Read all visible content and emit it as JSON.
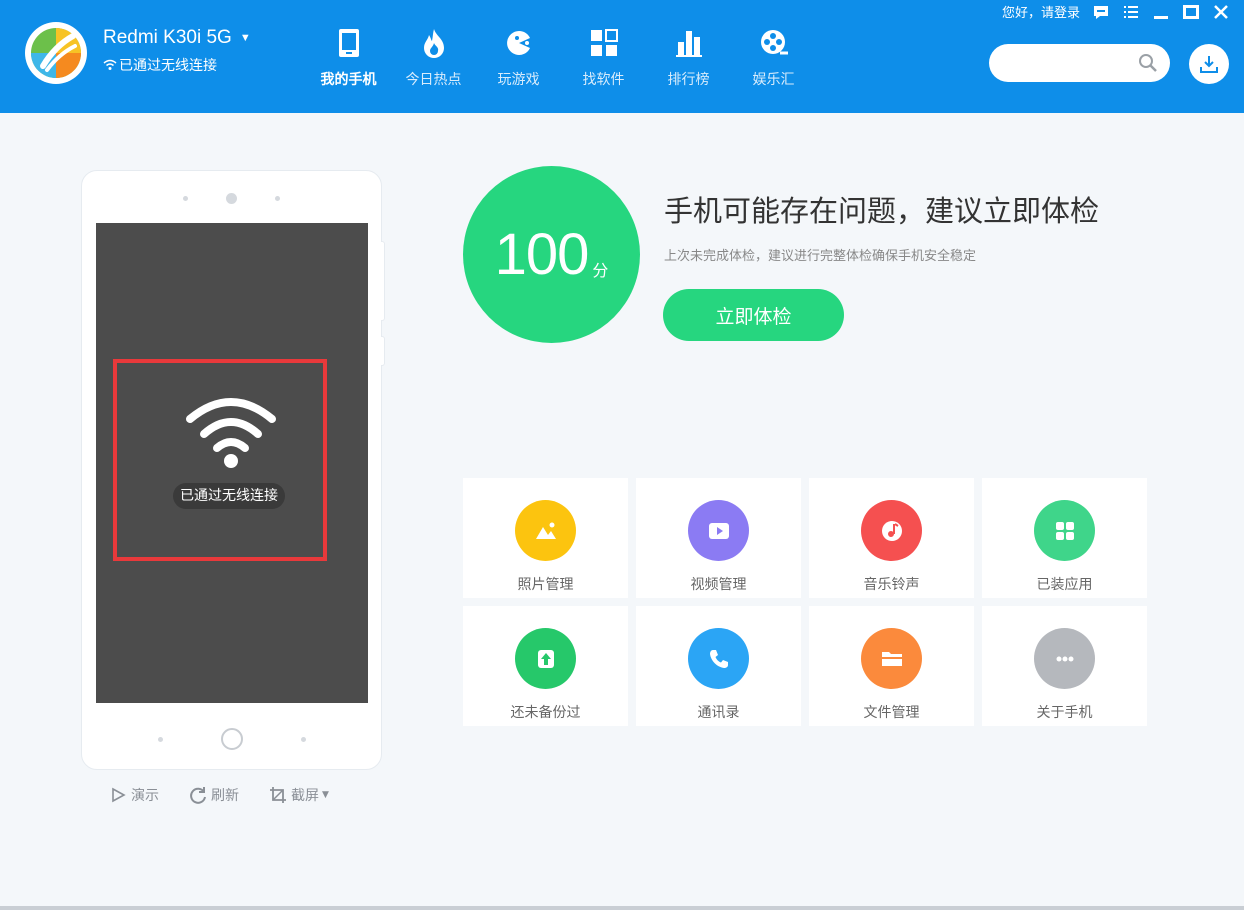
{
  "header": {
    "device_name": "Redmi K30i 5G",
    "device_status": "已通过无线连接",
    "nav": [
      {
        "label": "我的手机",
        "icon": "phone-icon",
        "active": true
      },
      {
        "label": "今日热点",
        "icon": "flame-icon",
        "active": false
      },
      {
        "label": "玩游戏",
        "icon": "pacman-icon",
        "active": false
      },
      {
        "label": "找软件",
        "icon": "apps-grid-icon",
        "active": false
      },
      {
        "label": "排行榜",
        "icon": "bar-chart-icon",
        "active": false
      },
      {
        "label": "娱乐汇",
        "icon": "film-reel-icon",
        "active": false
      }
    ],
    "login_text": "您好，请登录",
    "search_placeholder": "",
    "brand_color": "#0e8ee9"
  },
  "phone": {
    "screen_label": "已通过无线连接",
    "actions": [
      {
        "label": "演示",
        "icon": "play-icon"
      },
      {
        "label": "刷新",
        "icon": "refresh-icon"
      },
      {
        "label": "截屏",
        "icon": "crop-icon"
      }
    ]
  },
  "score": {
    "value": "100",
    "unit": "分",
    "title": "手机可能存在问题，建议立即体检",
    "subtitle": "上次未完成体检，建议进行完整体检确保手机安全稳定",
    "button_label": "立即体检",
    "color": "#26d67f"
  },
  "tiles": [
    {
      "label": "照片管理",
      "icon": "photo-icon",
      "color": "#fcc40f"
    },
    {
      "label": "视频管理",
      "icon": "video-icon",
      "color": "#8b7bf3"
    },
    {
      "label": "音乐铃声",
      "icon": "music-icon",
      "color": "#f55050"
    },
    {
      "label": "已装应用",
      "icon": "apps-icon",
      "color": "#3fd58a"
    },
    {
      "label": "还未备份过",
      "icon": "backup-icon",
      "color": "#26c86a"
    },
    {
      "label": "通讯录",
      "icon": "contacts-phone-icon",
      "color": "#2ba5f5"
    },
    {
      "label": "文件管理",
      "icon": "folder-icon",
      "color": "#fb8a3c"
    },
    {
      "label": "关于手机",
      "icon": "more-icon",
      "color": "#b5b8bd"
    }
  ]
}
